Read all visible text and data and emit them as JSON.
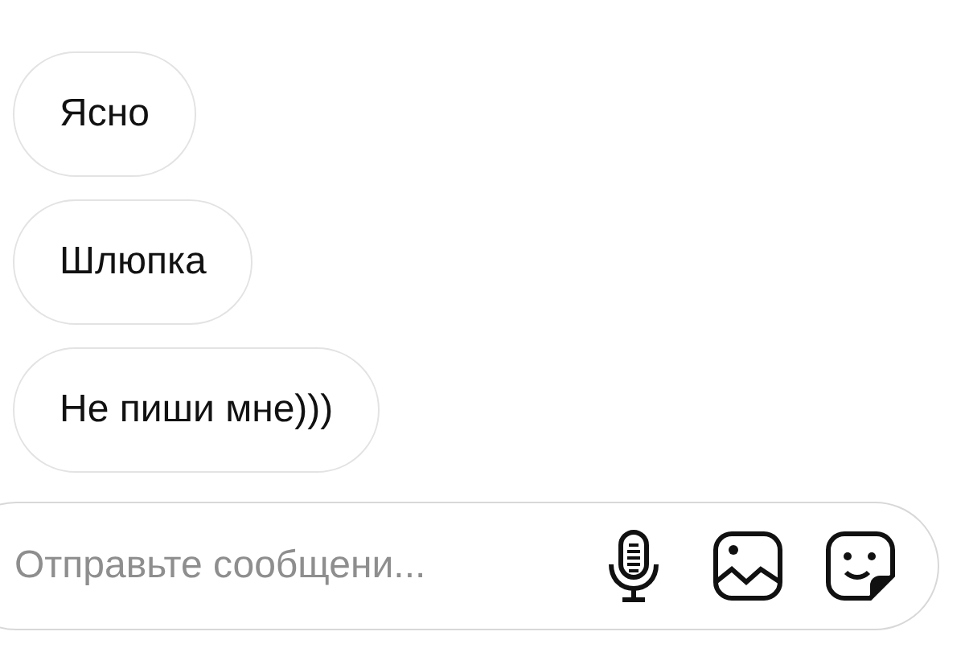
{
  "messages": [
    {
      "text": "Ясно"
    },
    {
      "text": "Шлюпка"
    },
    {
      "text": "Не пиши мне)))"
    }
  ],
  "composer": {
    "placeholder": "Отправьте сообщени..."
  }
}
